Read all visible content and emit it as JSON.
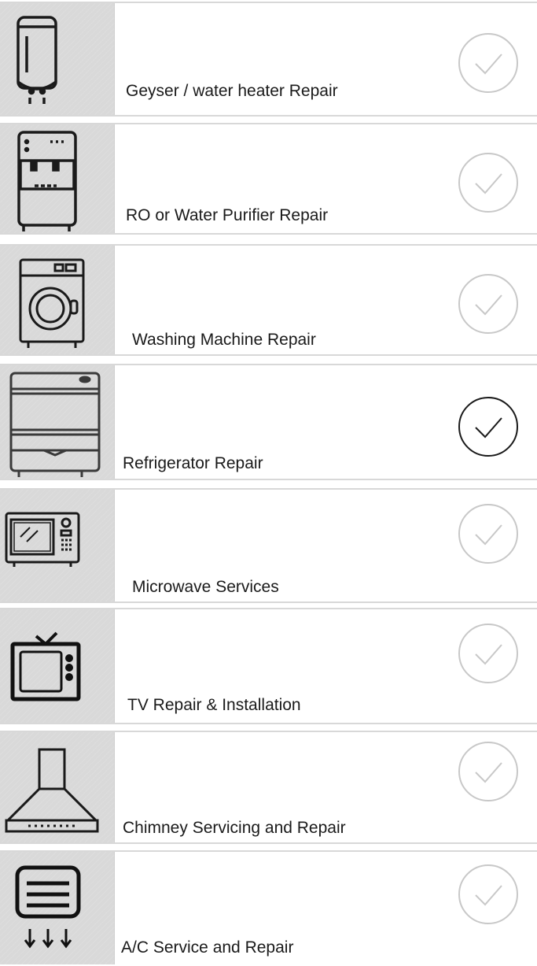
{
  "services": [
    {
      "label": "Geyser / water heater Repair",
      "icon": "geyser-icon",
      "selected": false
    },
    {
      "label": "RO or Water Purifier Repair",
      "icon": "water-purifier-icon",
      "selected": false
    },
    {
      "label": "Washing Machine Repair",
      "icon": "washing-machine-icon",
      "selected": false
    },
    {
      "label": "Refrigerator Repair",
      "icon": "refrigerator-icon",
      "selected": true
    },
    {
      "label": "Microwave Services",
      "icon": "microwave-icon",
      "selected": false
    },
    {
      "label": "TV  Repair & Installation",
      "icon": "tv-icon",
      "selected": false
    },
    {
      "label": "Chimney Servicing and Repair",
      "icon": "chimney-icon",
      "selected": false
    },
    {
      "label": "A/C Service and Repair",
      "icon": "ac-icon",
      "selected": false
    }
  ],
  "colors": {
    "thumb_bg": "#d9d9d9",
    "check_selected": "#1a1a1a",
    "check_unselected": "#c8c8c8",
    "divider": "#d8d8d8"
  }
}
